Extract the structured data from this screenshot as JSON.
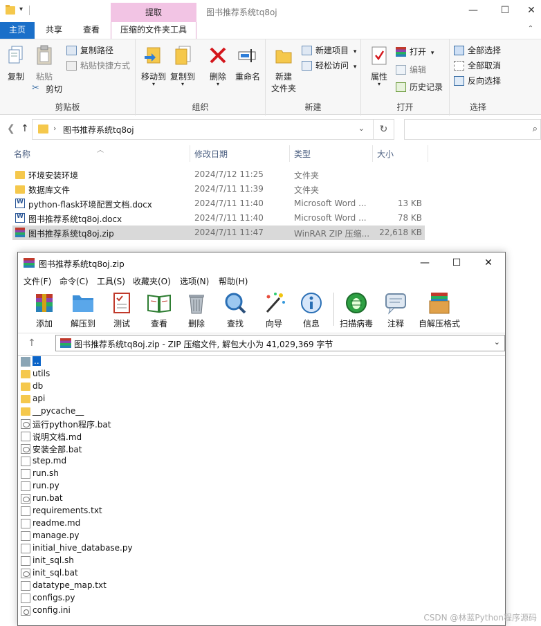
{
  "explorer": {
    "window_title": "图书推荐系统tq8oj",
    "context_tab_header": "提取",
    "tabs": [
      "主页",
      "共享",
      "查看",
      "压缩的文件夹工具"
    ],
    "ribbon": {
      "clipboard": {
        "label": "剪贴板",
        "copy": "复制",
        "paste": "粘贴",
        "copy_path": "复制路径",
        "paste_shortcut": "粘贴快捷方式",
        "cut": "剪切"
      },
      "organize": {
        "label": "组织",
        "move_to": "移动到",
        "copy_to": "复制到",
        "delete": "删除",
        "rename": "重命名"
      },
      "new": {
        "label": "新建",
        "new_folder_line1": "新建",
        "new_folder_line2": "文件夹",
        "new_item": "新建项目",
        "easy_access": "轻松访问"
      },
      "open": {
        "label": "打开",
        "properties": "属性",
        "open": "打开",
        "edit": "编辑",
        "history": "历史记录"
      },
      "select": {
        "label": "选择",
        "select_all": "全部选择",
        "select_none": "全部取消",
        "invert": "反向选择"
      }
    },
    "address": {
      "path": "图书推荐系统tq8oj",
      "search_placeholder": ""
    },
    "columns": {
      "name": "名称",
      "date": "修改日期",
      "type": "类型",
      "size": "大小"
    },
    "files": [
      {
        "name": "环境安装环境",
        "date": "2024/7/12 11:25",
        "type": "文件夹",
        "size": "",
        "icon": "folder-icon"
      },
      {
        "name": "数据库文件",
        "date": "2024/7/11 11:39",
        "type": "文件夹",
        "size": "",
        "icon": "folder-icon"
      },
      {
        "name": "python-flask环境配置文档.docx",
        "date": "2024/7/11 11:40",
        "type": "Microsoft Word ...",
        "size": "13 KB",
        "icon": "word-doc-icon"
      },
      {
        "name": "图书推荐系统tq8oj.docx",
        "date": "2024/7/11 11:40",
        "type": "Microsoft Word ...",
        "size": "78 KB",
        "icon": "word-doc-icon"
      },
      {
        "name": "图书推荐系统tq8oj.zip",
        "date": "2024/7/11 11:47",
        "type": "WinRAR ZIP 压缩...",
        "size": "22,618 KB",
        "icon": "winrar-archive-icon",
        "selected": true
      }
    ]
  },
  "winrar": {
    "title": "图书推荐系统tq8oj.zip",
    "menu": [
      "文件(F)",
      "命令(C)",
      "工具(S)",
      "收藏夹(O)",
      "选项(N)",
      "帮助(H)"
    ],
    "toolbar": [
      "添加",
      "解压到",
      "测试",
      "查看",
      "删除",
      "查找",
      "向导",
      "信息",
      "扫描病毒",
      "注释",
      "自解压格式"
    ],
    "path_text": "图书推荐系统tq8oj.zip - ZIP 压缩文件, 解包大小为 41,029,369 字节",
    "entries": [
      {
        "name": "..",
        "icon": "parent-folder-icon"
      },
      {
        "name": "utils",
        "icon": "folder-icon"
      },
      {
        "name": "db",
        "icon": "folder-icon"
      },
      {
        "name": "api",
        "icon": "folder-icon"
      },
      {
        "name": "__pycache__",
        "icon": "folder-icon"
      },
      {
        "name": "运行python程序.bat",
        "icon": "batch-file-icon"
      },
      {
        "name": "说明文档.md",
        "icon": "file-icon"
      },
      {
        "name": "安装全部.bat",
        "icon": "batch-file-icon"
      },
      {
        "name": "step.md",
        "icon": "file-icon"
      },
      {
        "name": "run.sh",
        "icon": "file-icon"
      },
      {
        "name": "run.py",
        "icon": "file-icon"
      },
      {
        "name": "run.bat",
        "icon": "batch-file-icon"
      },
      {
        "name": "requirements.txt",
        "icon": "text-file-icon"
      },
      {
        "name": "readme.md",
        "icon": "file-icon"
      },
      {
        "name": "manage.py",
        "icon": "file-icon"
      },
      {
        "name": "initial_hive_database.py",
        "icon": "file-icon"
      },
      {
        "name": "init_sql.sh",
        "icon": "file-icon"
      },
      {
        "name": "init_sql.bat",
        "icon": "batch-file-icon"
      },
      {
        "name": "datatype_map.txt",
        "icon": "text-file-icon"
      },
      {
        "name": "configs.py",
        "icon": "file-icon"
      },
      {
        "name": "config.ini",
        "icon": "settings-file-icon"
      }
    ]
  },
  "watermark": "CSDN @林蓝Python程序源码",
  "colors": {
    "accent": "#1a6fc9",
    "context_tab": "#f2c4e4",
    "selection": "#0a64c8"
  }
}
